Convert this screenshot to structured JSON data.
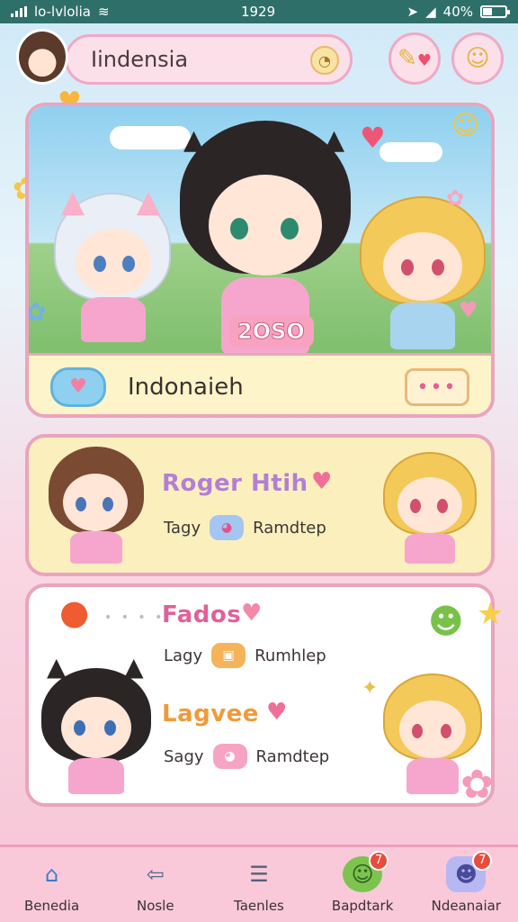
{
  "status_bar": {
    "carrier": "lo-lvlolia",
    "time": "1929",
    "battery": "40%",
    "battery_level": 0.4
  },
  "header": {
    "search_value": "Iindensia"
  },
  "hero": {
    "badge": "2OSO",
    "title": "Indonaieh",
    "more_label": "•••"
  },
  "entries": [
    {
      "name": "Roger Htih",
      "sub_label": "Tagy",
      "tag_label": "Ramdtep",
      "name_color": "#b37fd6"
    },
    {
      "name": "Fados",
      "sub_label": "Lagy",
      "tag_label": "Rumhlep",
      "name_color": "#e0609a"
    },
    {
      "name": "Lagvee",
      "sub_label": "Sagy",
      "tag_label": "Ramdtep",
      "name_color": "#f09a3a"
    }
  ],
  "bottom_nav": [
    {
      "label": "Benedia",
      "icon": "home-icon",
      "glyph": "⌂"
    },
    {
      "label": "Nosle",
      "icon": "back-arrow-icon",
      "glyph": "⇦"
    },
    {
      "label": "Taenles",
      "icon": "list-icon",
      "glyph": "☰"
    },
    {
      "label": "Bapdtark",
      "icon": "green-face-icon",
      "glyph": "☺",
      "badge": "7"
    },
    {
      "label": "Ndeanaiar",
      "icon": "robot-face-icon",
      "glyph": "☻",
      "badge": "7"
    }
  ],
  "colors": {
    "accent_pink": "#f0a9c4",
    "card_border": "#e9a5bd",
    "status_bar": "#2f6f6a"
  }
}
